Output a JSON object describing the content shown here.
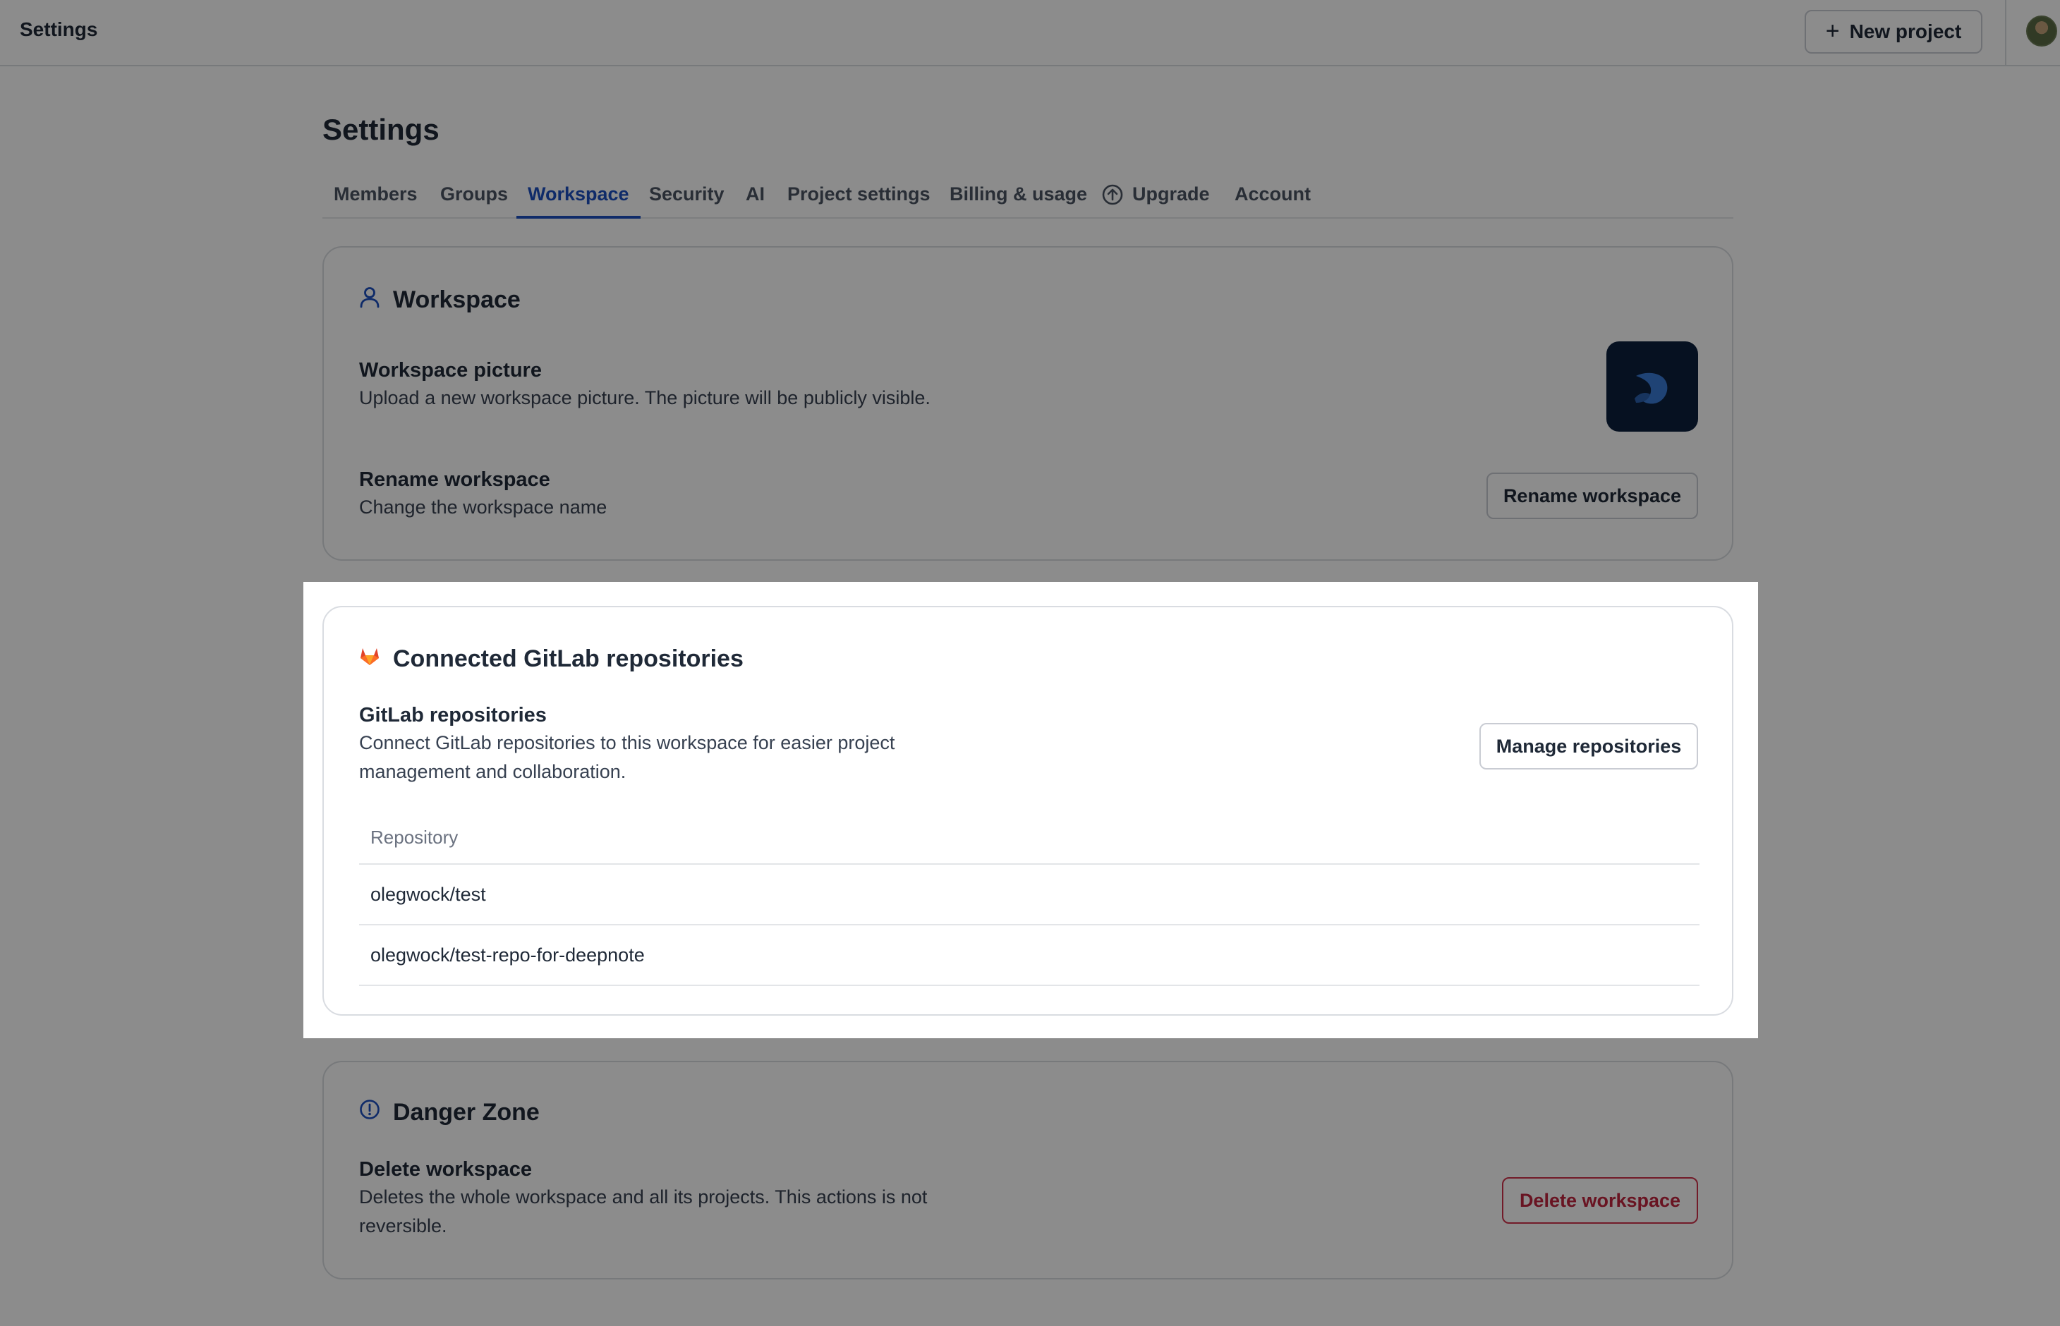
{
  "topbar": {
    "title": "Settings",
    "new_project_label": "New project",
    "plus_icon": "+"
  },
  "page": {
    "heading": "Settings"
  },
  "tabs": [
    {
      "label": "Members"
    },
    {
      "label": "Groups"
    },
    {
      "label": "Workspace",
      "active": true
    },
    {
      "label": "Security"
    },
    {
      "label": "AI"
    },
    {
      "label": "Project settings"
    },
    {
      "label": "Billing & usage"
    },
    {
      "label": "Upgrade",
      "icon": "arrow-up-circle-icon"
    },
    {
      "label": "Account"
    }
  ],
  "workspace_card": {
    "title": "Workspace",
    "icon": "user-icon",
    "picture": {
      "title": "Workspace picture",
      "description": "Upload a new workspace picture. The picture will be publicly visible."
    },
    "rename": {
      "title": "Rename workspace",
      "description": "Change the workspace name",
      "button_label": "Rename workspace"
    }
  },
  "gitlab_card": {
    "title": "Connected GitLab repositories",
    "icon": "gitlab-icon",
    "section_title": "GitLab repositories",
    "description_line1": "Connect GitLab repositories to this workspace for easier project",
    "description_line2": "management and collaboration.",
    "manage_button_label": "Manage repositories",
    "table": {
      "column_header": "Repository",
      "rows": [
        {
          "name": "olegwock/test"
        },
        {
          "name": "olegwock/test-repo-for-deepnote"
        }
      ]
    }
  },
  "danger_card": {
    "title": "Danger Zone",
    "icon": "alert-circle-icon",
    "section_title": "Delete workspace",
    "description_line1": "Deletes the whole workspace and all its projects. This actions is not",
    "description_line2": "reversible.",
    "delete_button_label": "Delete workspace"
  },
  "colors": {
    "accent": "#1d4fbf",
    "danger": "#c0263e",
    "gitlab_orange": "#e24329",
    "workspace_logo_bg": "#0b1f3d"
  }
}
